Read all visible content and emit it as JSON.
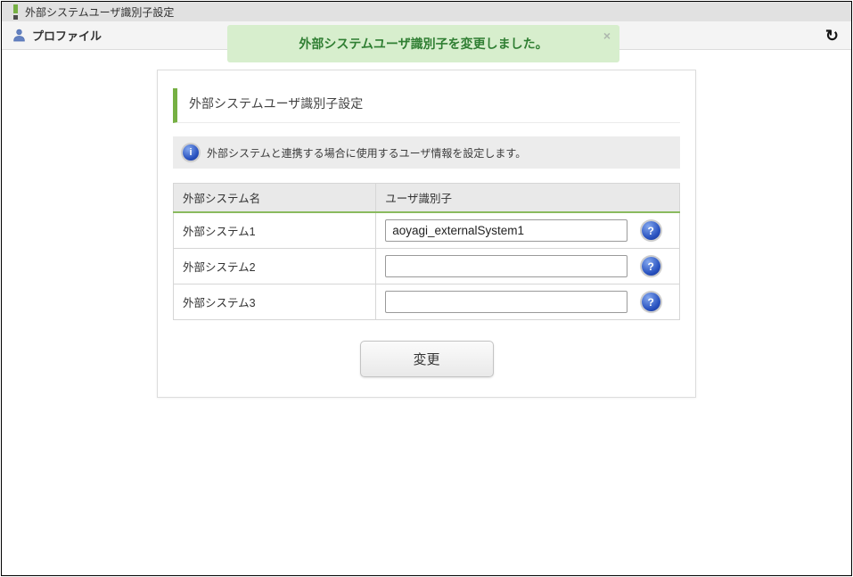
{
  "colors": {
    "accent_green": "#76b043",
    "toast_bg": "#d7eecd",
    "toast_text": "#2f7e32",
    "help_icon_blue": "#2a53c0",
    "top_bar_bg": "#e1e1e1",
    "profile_bar_bg": "#f4f4f4",
    "info_box_bg": "#ececec"
  },
  "icons": {
    "refresh": "↻",
    "close": "×",
    "help": "?",
    "info": "i"
  },
  "top_bar": {
    "title": "外部システムユーザ識別子設定"
  },
  "profile_bar": {
    "label": "プロファイル"
  },
  "toast": {
    "message": "外部システムユーザ識別子を変更しました。"
  },
  "card": {
    "title": "外部システムユーザ識別子設定",
    "info_text": "外部システムと連携する場合に使用するユーザ情報を設定します。",
    "table": {
      "headers": [
        "外部システム名",
        "ユーザ識別子"
      ],
      "rows": [
        {
          "system_name": "外部システム1",
          "identifier_value": "aoyagi_externalSystem1"
        },
        {
          "system_name": "外部システム2",
          "identifier_value": ""
        },
        {
          "system_name": "外部システム3",
          "identifier_value": ""
        }
      ]
    },
    "submit_label": "変更"
  }
}
